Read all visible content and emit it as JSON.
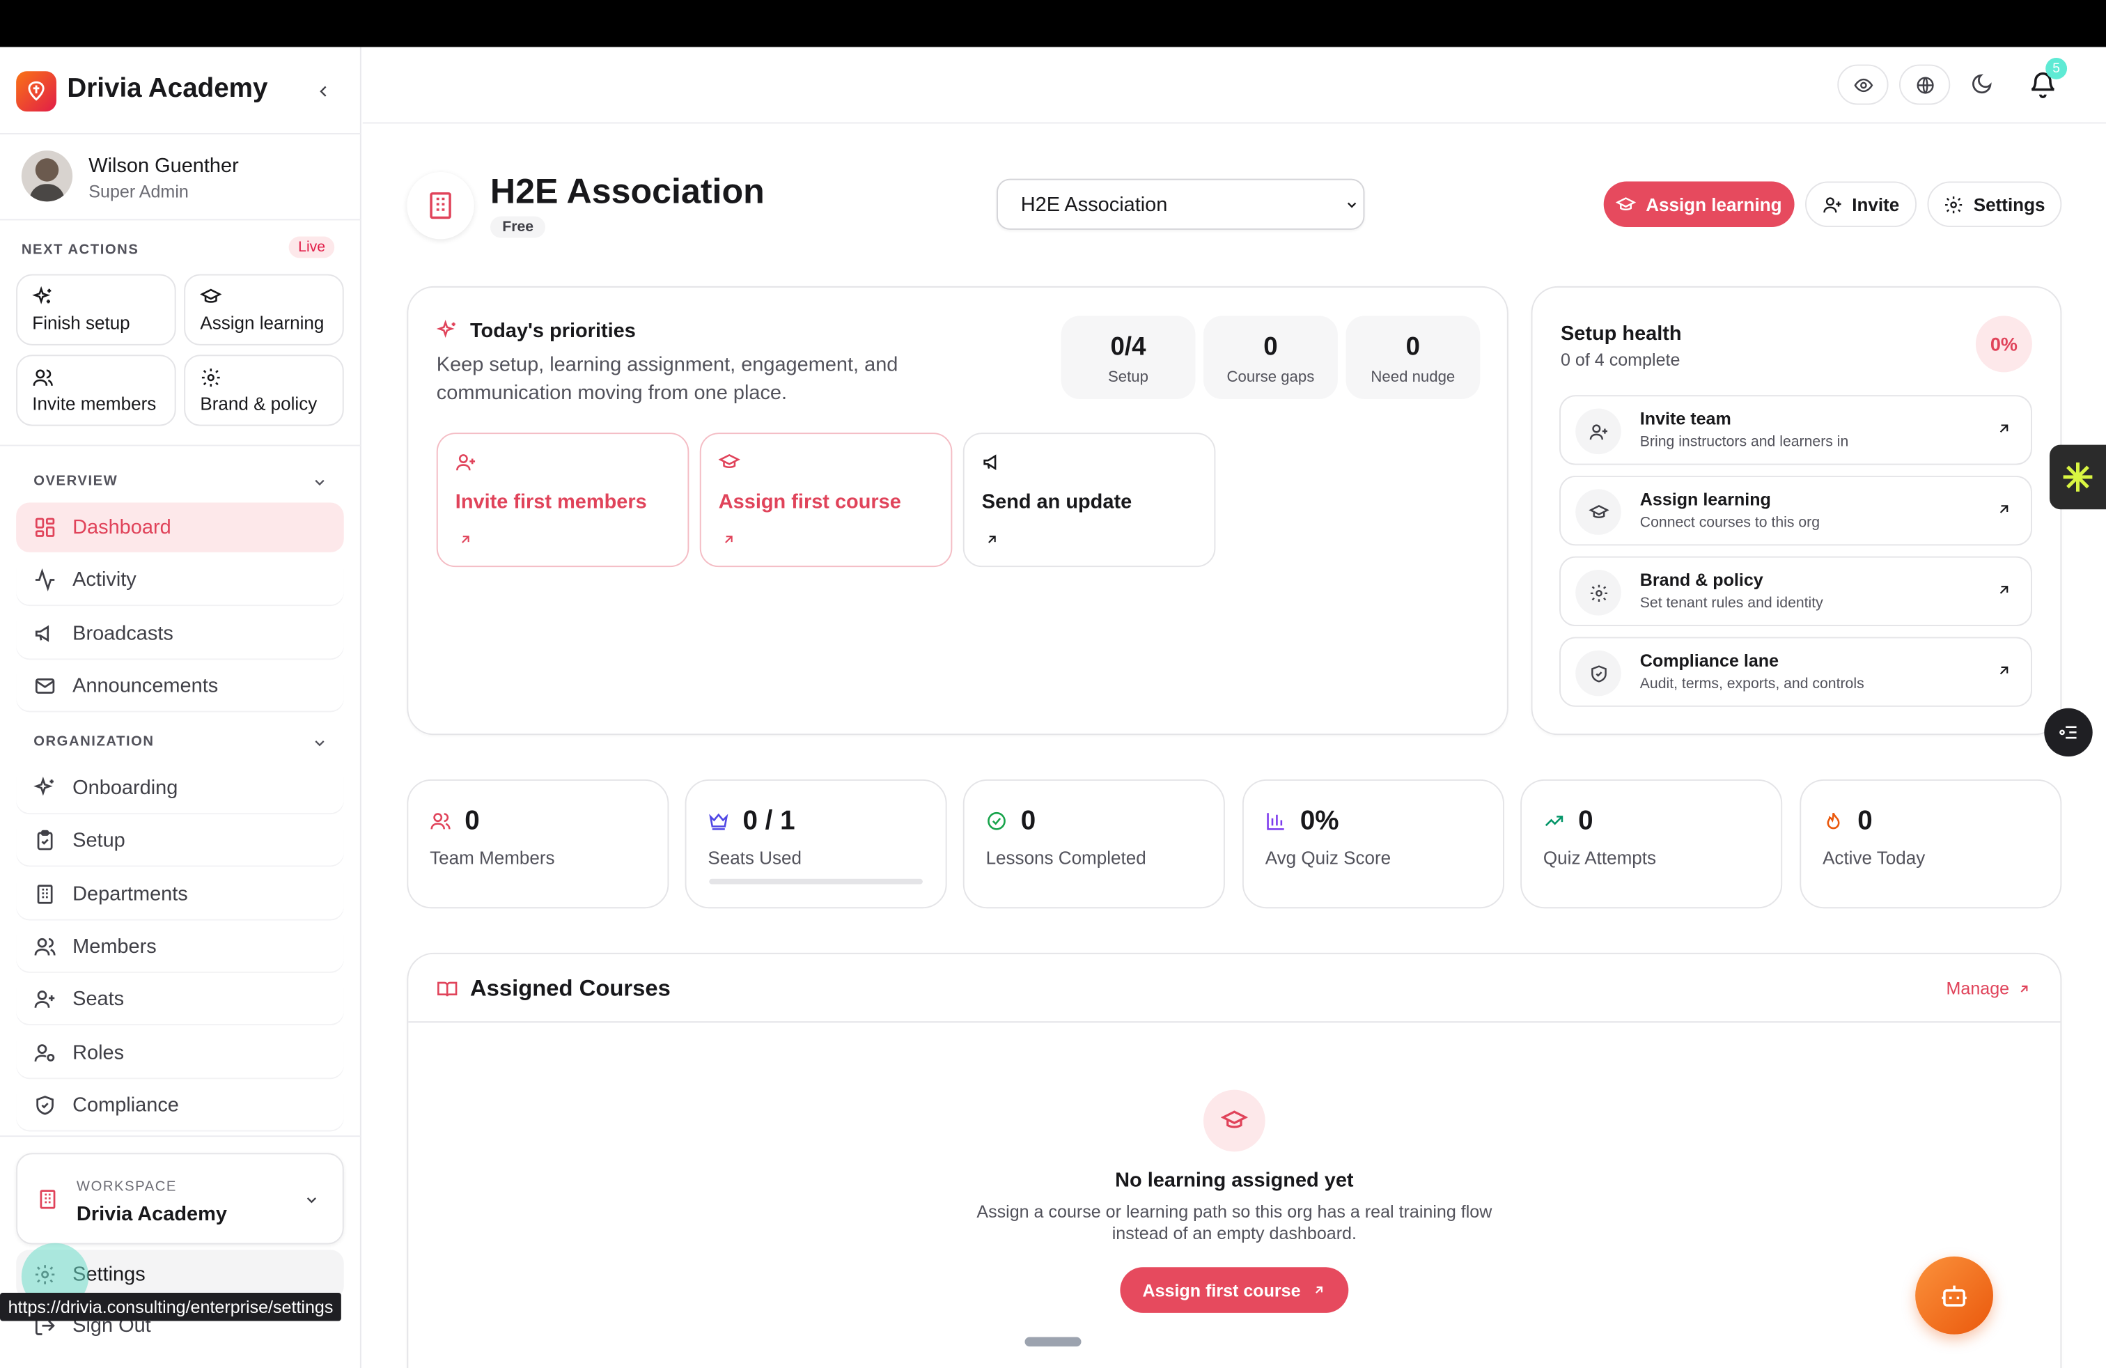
{
  "app": {
    "name": "Drivia Academy"
  },
  "user": {
    "name": "Wilson Guenther",
    "role": "Super Admin"
  },
  "next_actions": {
    "label": "NEXT ACTIONS",
    "badge": "Live",
    "items": [
      {
        "label": "Finish setup",
        "icon": "sparkles-icon"
      },
      {
        "label": "Assign learning",
        "icon": "graduation-cap-icon"
      },
      {
        "label": "Invite members",
        "icon": "users-icon"
      },
      {
        "label": "Brand & policy",
        "icon": "gear-icon"
      }
    ]
  },
  "sidebar": {
    "overview_label": "OVERVIEW",
    "overview": [
      {
        "label": "Dashboard",
        "icon": "grid-icon",
        "active": true
      },
      {
        "label": "Activity",
        "icon": "activity-icon"
      },
      {
        "label": "Broadcasts",
        "icon": "megaphone-icon"
      },
      {
        "label": "Announcements",
        "icon": "mail-icon"
      }
    ],
    "organization_label": "ORGANIZATION",
    "organization": [
      {
        "label": "Onboarding",
        "icon": "sparkles-icon"
      },
      {
        "label": "Setup",
        "icon": "clipboard-icon"
      },
      {
        "label": "Departments",
        "icon": "building-icon"
      },
      {
        "label": "Members",
        "icon": "users-icon"
      },
      {
        "label": "Seats",
        "icon": "user-plus-icon"
      },
      {
        "label": "Roles",
        "icon": "user-cog-icon"
      },
      {
        "label": "Compliance",
        "icon": "shield-icon"
      }
    ],
    "workspace_label": "WORKSPACE",
    "workspace_name": "Drivia Academy",
    "settings": "Settings",
    "sign_out": "Sign Out",
    "status_url": "https://drivia.consulting/enterprise/settings"
  },
  "header": {
    "notifications_count": "5"
  },
  "org": {
    "name": "H2E Association",
    "plan": "Free",
    "selected": "H2E Association"
  },
  "actions": {
    "assign": "Assign learning",
    "invite": "Invite",
    "settings": "Settings"
  },
  "priorities": {
    "title": "Today's priorities",
    "description": "Keep setup, learning assignment, engagement, and communication moving from one place.",
    "stats": [
      {
        "value": "0/4",
        "label": "Setup"
      },
      {
        "value": "0",
        "label": "Course gaps"
      },
      {
        "value": "0",
        "label": "Need nudge"
      }
    ],
    "cards": [
      {
        "label": "Invite first members",
        "highlight": true
      },
      {
        "label": "Assign first course",
        "highlight": true
      },
      {
        "label": "Send an update",
        "highlight": false
      }
    ]
  },
  "setup_health": {
    "title": "Setup health",
    "subtitle": "0 of 4 complete",
    "percent": "0%",
    "items": [
      {
        "title": "Invite team",
        "subtitle": "Bring instructors and learners in",
        "icon": "user-plus-icon"
      },
      {
        "title": "Assign learning",
        "subtitle": "Connect courses to this org",
        "icon": "graduation-cap-icon"
      },
      {
        "title": "Brand & policy",
        "subtitle": "Set tenant rules and identity",
        "icon": "gear-icon"
      },
      {
        "title": "Compliance lane",
        "subtitle": "Audit, terms, exports, and controls",
        "icon": "shield-icon"
      }
    ]
  },
  "kpis": [
    {
      "value": "0",
      "label": "Team Members",
      "icon": "users-icon",
      "color": "#e0435a"
    },
    {
      "value": "0 / 1",
      "label": "Seats Used",
      "icon": "crown-icon",
      "color": "#4f46e5",
      "progress": 0
    },
    {
      "value": "0",
      "label": "Lessons Completed",
      "icon": "check-circle-icon",
      "color": "#16a34a"
    },
    {
      "value": "0%",
      "label": "Avg Quiz Score",
      "icon": "bar-chart-icon",
      "color": "#7c3aed"
    },
    {
      "value": "0",
      "label": "Quiz Attempts",
      "icon": "trending-up-icon",
      "color": "#059669"
    },
    {
      "value": "0",
      "label": "Active Today",
      "icon": "flame-icon",
      "color": "#ea580c"
    }
  ],
  "assigned_courses": {
    "title": "Assigned Courses",
    "manage": "Manage",
    "empty_title": "No learning assigned yet",
    "empty_desc_line1": "Assign a course or learning path so this org has a real training flow",
    "empty_desc_line2": "instead of an empty dashboard.",
    "cta": "Assign first course"
  },
  "colors": {
    "accent": "#e64a5e",
    "accent_soft": "#fde8ea",
    "fab": "#f97316"
  }
}
